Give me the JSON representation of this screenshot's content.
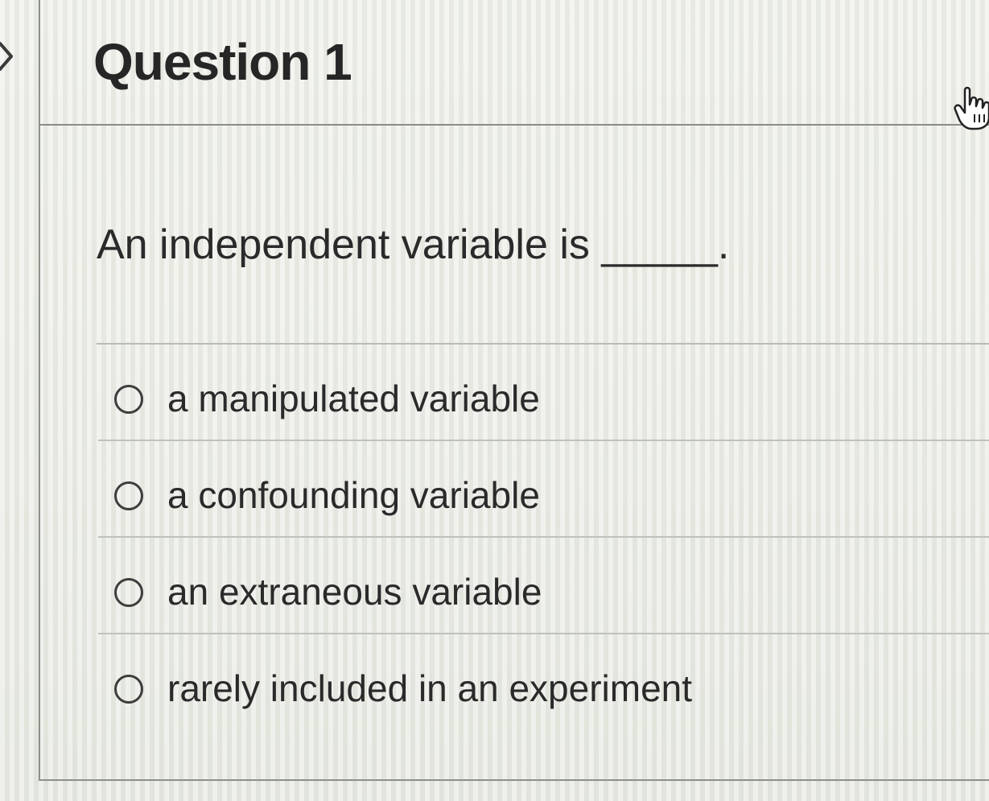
{
  "question": {
    "title": "Question 1",
    "prompt": "An independent variable is _____."
  },
  "answers": [
    {
      "label": "a manipulated variable"
    },
    {
      "label": "a confounding variable"
    },
    {
      "label": "an extraneous variable"
    },
    {
      "label": "rarely included in an experiment"
    }
  ],
  "icons": {
    "collapse": "chevron-right-icon",
    "cursor": "hand-pointer-icon"
  },
  "colors": {
    "text": "#2a2a2a",
    "border": "#8d8f8a",
    "divider": "#bfc2bb"
  }
}
